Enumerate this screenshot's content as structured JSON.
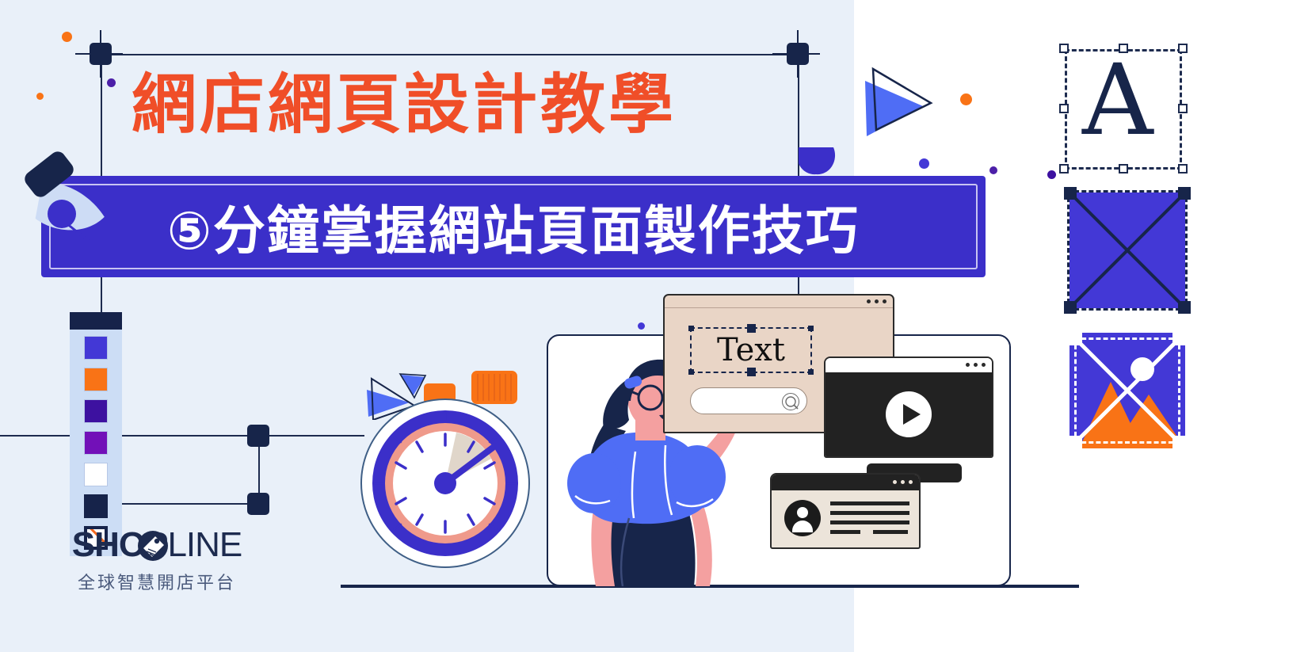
{
  "banner": {
    "headline": "網店網頁設計教學",
    "subtitle": "⑤分鐘掌握網站頁面製作技巧",
    "headline_color": "#f04e28",
    "subtitle_bar_color": "#3b2fc9",
    "subtitle_text_color": "#ffffff",
    "background_left_color": "#e9f0f9",
    "background_right_color": "#ffffff"
  },
  "logo": {
    "name_bold": "SHOP",
    "name_light": "LINE",
    "tagline": "全球智慧開店平台",
    "color": "#1d2b4f"
  },
  "palette": {
    "label": "color-palette",
    "swatches": [
      {
        "name": "indigo",
        "hex": "#4338d6"
      },
      {
        "name": "orange",
        "hex": "#f97316"
      },
      {
        "name": "dark-purple",
        "hex": "#3d11a0"
      },
      {
        "name": "purple",
        "hex": "#7210b8"
      },
      {
        "name": "white",
        "hex": "#ffffff"
      },
      {
        "name": "navy",
        "hex": "#16234a"
      },
      {
        "name": "none",
        "hex": "#ffffff"
      }
    ]
  },
  "right_panels": [
    {
      "name": "text-tool-panel",
      "glyph": "A",
      "selected": true
    },
    {
      "name": "shape-tool-panel",
      "glyph": "",
      "selected": true
    },
    {
      "name": "image-tool-panel",
      "glyph": "",
      "selected": true
    }
  ],
  "text_window": {
    "word": "Text",
    "search_placeholder": "",
    "background": "#e9d5c6"
  },
  "video_window": {
    "name": "video-player",
    "state": "paused"
  },
  "profile_card": {
    "name": "profile-card"
  },
  "stopwatch": {
    "name": "stopwatch",
    "ring_color": "#3b2fc9",
    "inner_ring_color": "#ef9a8b"
  },
  "illustration": {
    "character": "woman-pointing",
    "shirt_color": "#4f6df5",
    "hair_color": "#17254a",
    "skin_color": "#f4a0a0"
  }
}
